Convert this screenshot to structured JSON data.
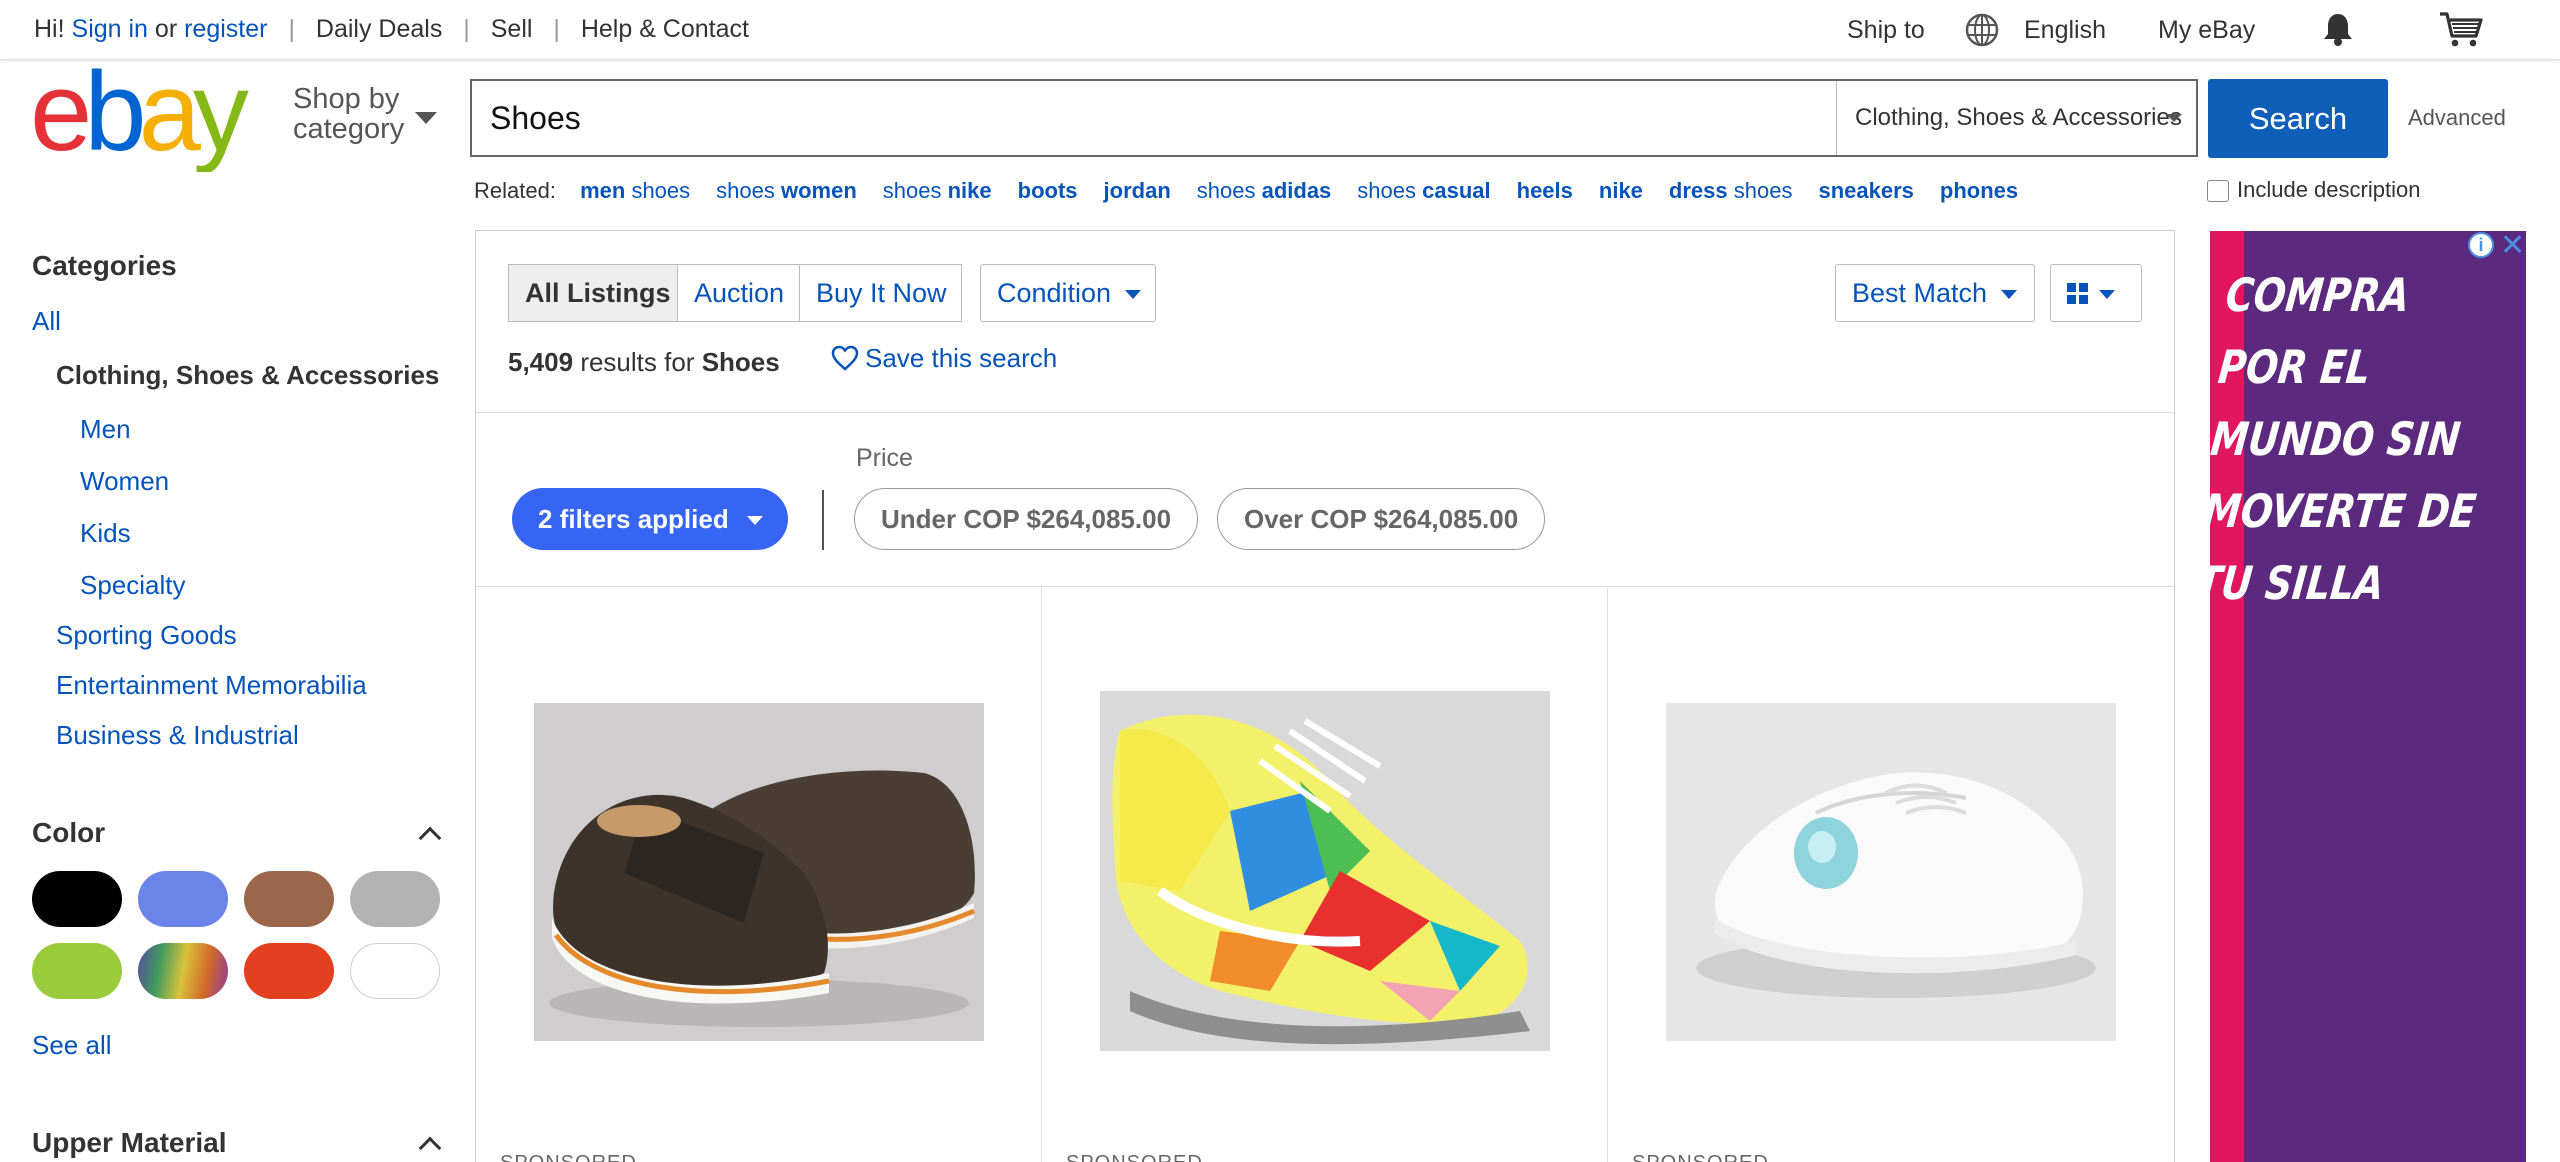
{
  "topbar": {
    "greeting": "Hi!",
    "sign_in": "Sign in",
    "or": "or",
    "register": "register",
    "daily_deals": "Daily Deals",
    "sell": "Sell",
    "help": "Help & Contact",
    "ship_to": "Ship to",
    "language": "English",
    "my_ebay": "My eBay"
  },
  "header": {
    "shop_by_1": "Shop by",
    "shop_by_2": "category",
    "search_value": "Shoes",
    "category": "Clothing, Shoes & Accessories",
    "search_button": "Search",
    "advanced": "Advanced",
    "include_description": "Include description"
  },
  "related": {
    "label": "Related:",
    "items": [
      {
        "a": "men",
        "b": " shoes",
        "bold_first": true
      },
      {
        "a": "shoes ",
        "b": "women",
        "bold_first": false
      },
      {
        "a": "shoes ",
        "b": "nike",
        "bold_first": false
      },
      {
        "a": "boots",
        "b": "",
        "bold_first": true
      },
      {
        "a": "jordan",
        "b": "",
        "bold_first": true
      },
      {
        "a": "shoes ",
        "b": "adidas",
        "bold_first": false
      },
      {
        "a": "shoes ",
        "b": "casual",
        "bold_first": false
      },
      {
        "a": "heels",
        "b": "",
        "bold_first": true
      },
      {
        "a": "nike",
        "b": "",
        "bold_first": true
      },
      {
        "a": "dress",
        "b": " shoes",
        "bold_first": true
      },
      {
        "a": "sneakers",
        "b": "",
        "bold_first": true
      },
      {
        "a": "phones",
        "b": "",
        "bold_first": true
      }
    ]
  },
  "sidebar": {
    "categories_title": "Categories",
    "all": "All",
    "current": "Clothing, Shoes & Accessories",
    "sub": [
      "Men",
      "Women",
      "Kids",
      "Specialty"
    ],
    "others": [
      "Sporting Goods",
      "Entertainment Memorabilia",
      "Business & Industrial"
    ],
    "color_title": "Color",
    "colors": [
      "#000000",
      "#6b84ea",
      "#9b664a",
      "#b3b3b3",
      "#9acb3d",
      "multicolor",
      "#e2401f",
      "#ffffff"
    ],
    "see_all": "See all",
    "upper_material_title": "Upper Material"
  },
  "results": {
    "tabs": [
      "All Listings",
      "Auction",
      "Buy It Now"
    ],
    "condition": "Condition",
    "sort": "Best Match",
    "count": "5,409",
    "results_for": "results for",
    "query": "Shoes",
    "save_search": "Save this search",
    "filters_applied": "2 filters applied",
    "price_label": "Price",
    "price_under": "Under COP $264,085.00",
    "price_over": "Over COP $264,085.00",
    "sponsored": "SPONSORED"
  },
  "ad": {
    "lines": [
      "COMPRA",
      "POR EL",
      "MUNDO SIN",
      "MOVERTE DE",
      "TU SILLA"
    ],
    "info": "i",
    "close": "✕"
  }
}
